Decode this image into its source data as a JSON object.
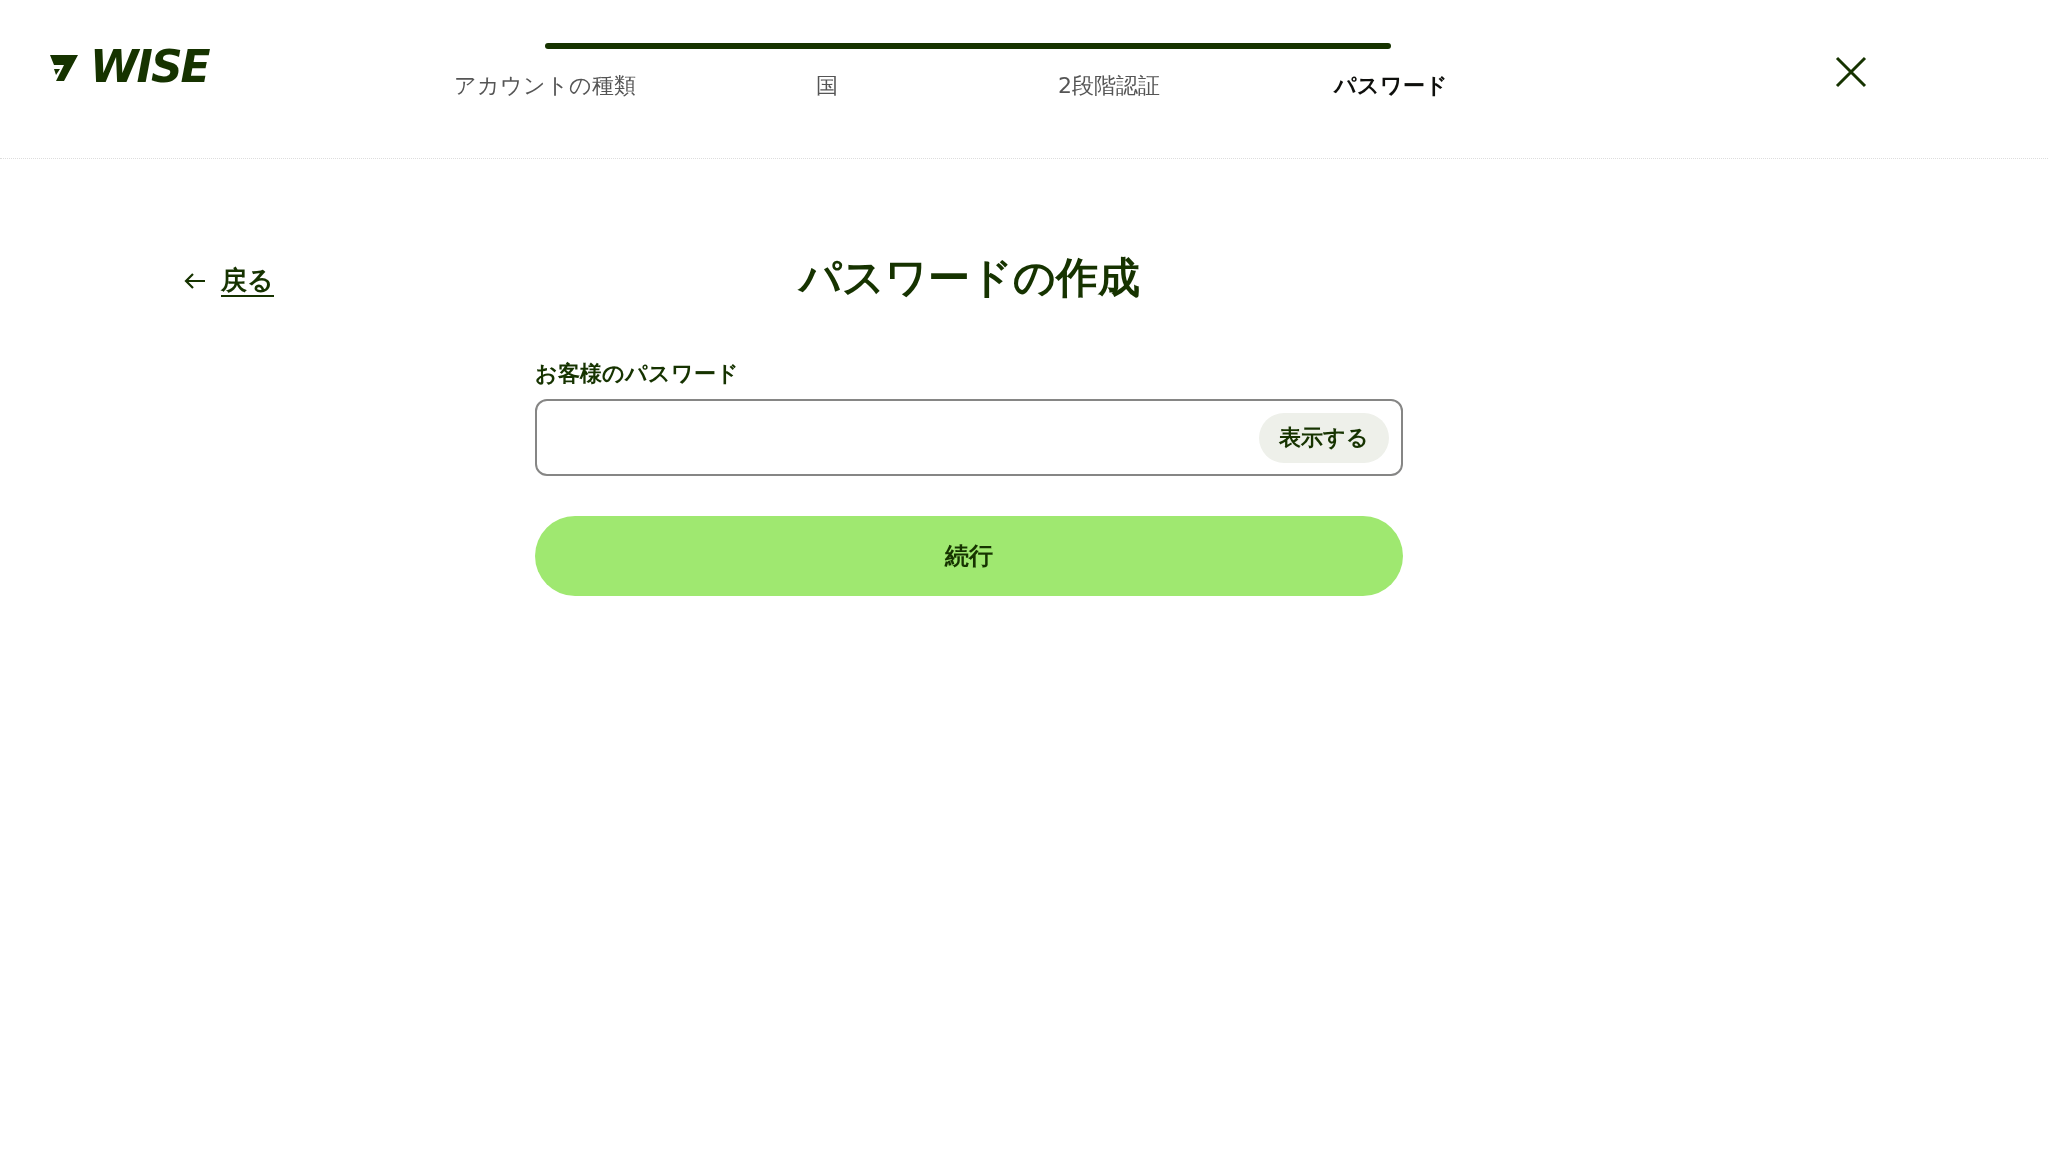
{
  "logo": {
    "text": "WISE"
  },
  "progress": {
    "steps": [
      {
        "label": "アカウントの種類",
        "selected": false
      },
      {
        "label": "国",
        "selected": false
      },
      {
        "label": "2段階認証",
        "selected": false
      },
      {
        "label": "パスワード",
        "selected": true
      }
    ]
  },
  "back_link": {
    "label": "戻る"
  },
  "title": "パスワードの作成",
  "password_field": {
    "label": "お客様のパスワード",
    "show_button": "表示する"
  },
  "continue_button": "続行"
}
